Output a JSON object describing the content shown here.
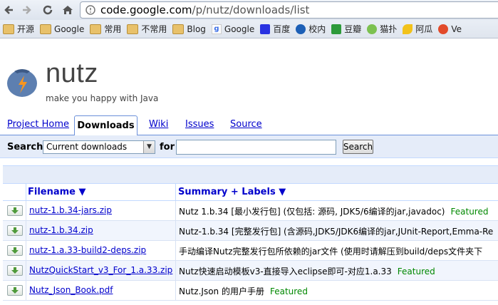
{
  "browser": {
    "url_host": "code.google.com",
    "url_path": "/p/nutz/downloads/list"
  },
  "bookmarks": [
    {
      "label": "开源",
      "icon": "folder-icon"
    },
    {
      "label": "Google",
      "icon": "folder-icon"
    },
    {
      "label": "常用",
      "icon": "folder-icon"
    },
    {
      "label": "不常用",
      "icon": "folder-icon"
    },
    {
      "label": "Blog",
      "icon": "folder-icon"
    },
    {
      "label": "Google",
      "icon": "google-icon"
    },
    {
      "label": "百度",
      "icon": "baidu-icon"
    },
    {
      "label": "校内",
      "icon": "xiaonei-icon"
    },
    {
      "label": "豆瓣",
      "icon": "douban-icon"
    },
    {
      "label": "猫扑",
      "icon": "mop-icon"
    },
    {
      "label": "阿瓜",
      "icon": "agua-icon"
    },
    {
      "label": "Ve",
      "icon": "ve-icon"
    }
  ],
  "project": {
    "name": "nutz",
    "tagline": "make you happy with Java"
  },
  "tabs": {
    "project_home": "Project Home",
    "downloads": "Downloads",
    "wiki": "Wiki",
    "issues": "Issues",
    "source": "Source"
  },
  "search": {
    "label": "Search",
    "scope_selected": "Current downloads",
    "for_label": "for",
    "query": "",
    "button": "Search"
  },
  "table": {
    "headers": {
      "filename": "Filename ▼",
      "summary": "Summary + Labels ▼"
    },
    "rows": [
      {
        "filename": "nutz-1.b.34-jars.zip",
        "summary": "Nutz 1.b.34 [最小发行包] (仅包括: 源码, JDK5/6编译的jar,javadoc)",
        "label": "Featured"
      },
      {
        "filename": "nutz-1.b.34.zip",
        "summary": "Nutz-1.b.34 [完整发行包] (含源码,JDK5/JDK6编译的jar,JUnit-Report,Emma-Re",
        "label": ""
      },
      {
        "filename": "nutz-1.a.33-build2-deps.zip",
        "summary": "手动编译Nutz完整发行包所依赖的jar文件 (使用时请解压到build/deps文件夹下",
        "label": ""
      },
      {
        "filename": "NutzQuickStart_v3_For_1.a.33.zip",
        "summary": "Nutz快速启动模板v3-直接导入eclipse即可-对应1.a.33",
        "label": "Featured"
      },
      {
        "filename": "Nutz_Json_Book.pdf",
        "summary": "Nutz.Json 的用户手册",
        "label": "Featured"
      }
    ]
  }
}
